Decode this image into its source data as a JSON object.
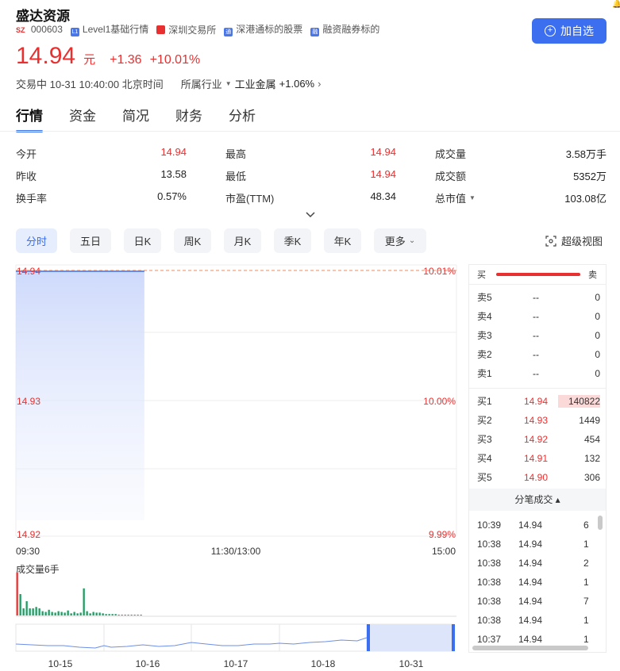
{
  "header": {
    "stock_name": "盛达资源",
    "market_badge": "SZ",
    "code": "000603",
    "tags": [
      {
        "icon": "L1",
        "label": "Level1基础行情",
        "color": "#4a76e8"
      },
      {
        "icon": "",
        "label": "深圳交易所",
        "color": "#e93030"
      },
      {
        "icon": "通",
        "label": "深港通标的股票",
        "color": "#4a76e8"
      },
      {
        "icon": "融",
        "label": "融资融券标的",
        "color": "#4a76e8"
      }
    ],
    "price": "14.94",
    "currency": "元",
    "change": "+1.36",
    "change_pct": "+10.01%",
    "status": "交易中 10-31 10:40:00 北京时间",
    "industry_label": "所属行业",
    "industry_name": "工业金属",
    "industry_change": "+1.06%",
    "add_watch_label": "加自选"
  },
  "tabs": [
    "行情",
    "资金",
    "简况",
    "财务",
    "分析"
  ],
  "stats": [
    [
      {
        "label": "今开",
        "value": "14.94",
        "color": "red"
      },
      {
        "label": "最高",
        "value": "14.94",
        "color": "red"
      },
      {
        "label": "成交量",
        "value": "3.58万手",
        "color": "black"
      }
    ],
    [
      {
        "label": "昨收",
        "value": "13.58",
        "color": "black"
      },
      {
        "label": "最低",
        "value": "14.94",
        "color": "red"
      },
      {
        "label": "成交额",
        "value": "5352万",
        "color": "black"
      }
    ],
    [
      {
        "label": "换手率",
        "value": "0.57%",
        "color": "black"
      },
      {
        "label": "市盈(TTM)",
        "value": "48.34",
        "color": "black"
      },
      {
        "label": "总市值",
        "value": "103.08亿",
        "color": "black"
      }
    ]
  ],
  "periods": [
    "分时",
    "五日",
    "日K",
    "周K",
    "月K",
    "季K",
    "年K",
    "更多"
  ],
  "super_view_label": "超级视图",
  "chart_labels": {
    "price_top": "14.94",
    "price_mid": "14.93",
    "price_bottom": "14.92",
    "pct_top": "10.01%",
    "pct_mid": "10.00%",
    "pct_bottom": "9.99%",
    "time_start": "09:30",
    "time_mid": "11:30/13:00",
    "time_end": "15:00",
    "volume_label": "成交量6手",
    "nav_dates": [
      "10-15",
      "10-16",
      "10-17",
      "10-18",
      "10-31"
    ]
  },
  "chart_data": {
    "type": "line",
    "title": "",
    "xlabel": "",
    "ylabel": "",
    "x": [
      "09:30",
      "10:40"
    ],
    "series": [
      {
        "values": [
          14.94,
          14.94
        ]
      }
    ],
    "ylim": [
      14.92,
      14.94
    ],
    "volume_bars": [
      6,
      3,
      1,
      2,
      1,
      1,
      1.2,
      1,
      0.6,
      0.5,
      0.8,
      0.5,
      0.4,
      0.6,
      0.5,
      0.4,
      0.7,
      0.3,
      0.5,
      0.3,
      0.4,
      3.8,
      0.6,
      0.3,
      0.5,
      0.4,
      0.4,
      0.3,
      0.2,
      0.2,
      0.2,
      0.2,
      0.1,
      0.1,
      0.1,
      0.1,
      0.1,
      0.1,
      0.1,
      0.1
    ]
  },
  "orderbook": {
    "buy_label": "买",
    "sell_label": "卖",
    "asks": [
      {
        "label": "卖5",
        "price": "--",
        "vol": "0"
      },
      {
        "label": "卖4",
        "price": "--",
        "vol": "0"
      },
      {
        "label": "卖3",
        "price": "--",
        "vol": "0"
      },
      {
        "label": "卖2",
        "price": "--",
        "vol": "0"
      },
      {
        "label": "卖1",
        "price": "--",
        "vol": "0"
      }
    ],
    "bids": [
      {
        "label": "买1",
        "price": "14.94",
        "vol": "140822"
      },
      {
        "label": "买2",
        "price": "14.93",
        "vol": "1449"
      },
      {
        "label": "买3",
        "price": "14.92",
        "vol": "454"
      },
      {
        "label": "买4",
        "price": "14.91",
        "vol": "132"
      },
      {
        "label": "买5",
        "price": "14.90",
        "vol": "306"
      }
    ],
    "trades_header": "分笔成交 ▴",
    "trades": [
      {
        "time": "10:39",
        "price": "14.94",
        "vol": "6"
      },
      {
        "time": "10:38",
        "price": "14.94",
        "vol": "1"
      },
      {
        "time": "10:38",
        "price": "14.94",
        "vol": "2"
      },
      {
        "time": "10:38",
        "price": "14.94",
        "vol": "1"
      },
      {
        "time": "10:38",
        "price": "14.94",
        "vol": "7"
      },
      {
        "time": "10:38",
        "price": "14.94",
        "vol": "1"
      },
      {
        "time": "10:37",
        "price": "14.94",
        "vol": "1"
      }
    ]
  }
}
